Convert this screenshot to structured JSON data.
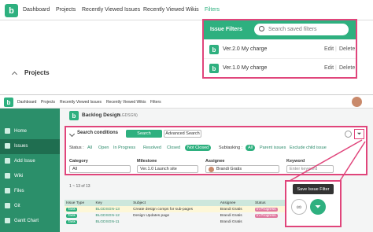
{
  "top_nav": {
    "logo_letter": "b",
    "items": [
      "Dashboard",
      "Projects",
      "Recently Viewed Issues",
      "Recently Viewed Wikis",
      "Filters"
    ]
  },
  "dropdown": {
    "title": "Issue Filters",
    "search_placeholder": "Search saved filters",
    "filters": [
      {
        "name": "Ver.2.0 My charge",
        "edit": "Edit",
        "delete": "Delete"
      },
      {
        "name": "Ver.1.0 My charge",
        "edit": "Edit",
        "delete": "Delete"
      }
    ]
  },
  "projects_label": "Projects",
  "second": {
    "nav": [
      "Dashboard",
      "Projects",
      "Recently Viewed Issues",
      "Recently Viewed Wikis",
      "Filters"
    ],
    "sidebar": [
      "Home",
      "Issues",
      "Add Issue",
      "Wiki",
      "Files",
      "Git",
      "Gantt Chart"
    ],
    "project_title": "Backlog Design",
    "project_key": "(BLGDSGN)",
    "search_conditions": "Search conditions",
    "tab_search": "Search",
    "tab_advanced": "Advanced Search",
    "status_label": "Status :",
    "status_items": [
      "All",
      "Open",
      "In Progress",
      "Resolved",
      "Closed",
      "Not Closed"
    ],
    "subtasking_label": "Subtasking :",
    "subtasking_items": [
      "All",
      "Parent issues",
      "Exclude child issue"
    ],
    "fields": {
      "category": {
        "label": "Category",
        "value": "All"
      },
      "milestone": {
        "label": "Milestone",
        "value": "Ver.1.0 Launch site"
      },
      "assignee": {
        "label": "Assignee",
        "value": "Brandi Gratis"
      },
      "keyword": {
        "label": "Keyword",
        "placeholder": "Enter keyword"
      }
    },
    "result_count": "1 ~ 13 of 13",
    "table_headers": [
      "Issue Type",
      "Key",
      "Subject",
      "Assignee",
      "Status"
    ],
    "rows": [
      {
        "type": "Task",
        "key": "BLGDSGN-13",
        "subject": "Create design comps for sub-pages",
        "assignee": "Brandi Gratis",
        "status": "In Progress"
      },
      {
        "type": "Task",
        "key": "BLGDSGN-12",
        "subject": "Design Updates page",
        "assignee": "Brandi Gratis",
        "status": "In Progress"
      },
      {
        "type": "Task",
        "key": "BLGDSGN-11",
        "subject": "",
        "assignee": "Brandi Gratis",
        "status": ""
      }
    ],
    "tooltip": "Save Issue Filter"
  },
  "colors": {
    "brand": "#2eb07f",
    "highlight": "#e0457b"
  }
}
